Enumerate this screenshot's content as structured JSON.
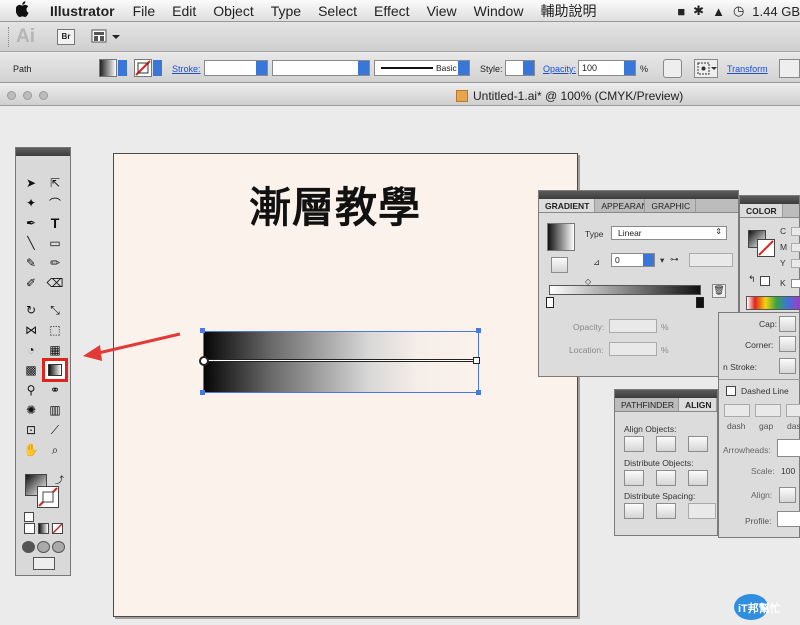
{
  "menubar": {
    "app": "Illustrator",
    "items": [
      "File",
      "Edit",
      "Object",
      "Type",
      "Select",
      "Effect",
      "View",
      "Window",
      "輔助說明"
    ],
    "storage": "1.44 GB"
  },
  "appbar": {
    "logo": "Ai",
    "bridge": "Br"
  },
  "control": {
    "selection": "Path",
    "stroke_label": "Stroke:",
    "brush": "Basic",
    "style_label": "Style:",
    "opacity_label": "Opacity:",
    "opacity_value": "100",
    "opacity_unit": "%",
    "transform_label": "Transform"
  },
  "document": {
    "title": "Untitled-1.ai* @ 100% (CMYK/Preview)"
  },
  "artboard": {
    "headline": "漸層教學"
  },
  "gradient_panel": {
    "tabs": [
      "GRADIENT",
      "APPEARAN",
      "GRAPHIC"
    ],
    "type_label": "Type",
    "type_value": "Linear",
    "angle_value": "0",
    "opacity_label": "Opacity:",
    "location_label": "Location:",
    "percent": "%"
  },
  "color_panel": {
    "tab": "COLOR",
    "channels": [
      "C",
      "M",
      "Y",
      "K"
    ]
  },
  "stroke_panel": {
    "cap_label": "Cap:",
    "corner_label": "Corner:",
    "align_label": "n Stroke:",
    "dashed_label": "Dashed Line",
    "dash_labels": [
      "dash",
      "gap",
      "das"
    ],
    "arrowheads_label": "Arrowheads:",
    "scale_label": "Scale:",
    "scale_value": "100",
    "align_arrows_label": "Align:",
    "profile_label": "Profile:"
  },
  "align_panel": {
    "tabs": [
      "PATHFINDER",
      "ALIGN"
    ],
    "align_objects": "Align Objects:",
    "distribute_objects": "Distribute Objects:",
    "distribute_spacing": "Distribute Spacing:"
  },
  "colors": {
    "highlight": "#e0231b",
    "selection_blue": "#4a78e0",
    "artboard": "#fcf2ec",
    "link_blue": "#1a4fd6"
  },
  "watermark": {
    "text": "iT邦幫忙"
  }
}
